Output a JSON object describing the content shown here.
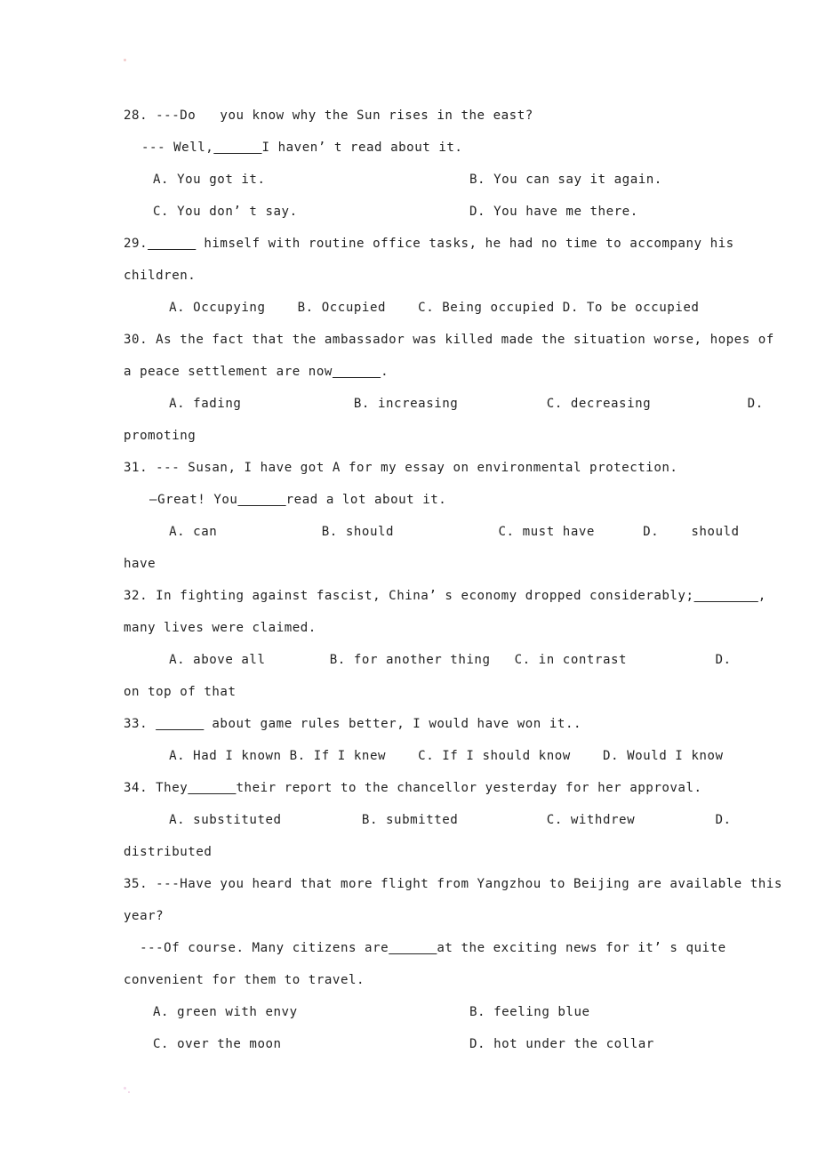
{
  "document": {
    "type": "exam-worksheet",
    "language": "en",
    "page_background": "#ffffff",
    "text_color": "#222222"
  },
  "questions": [
    {
      "number": "28.",
      "stem_lines": [
        "28. ---Do   you know why the Sun rises in the east?",
        "--- Well,______I haven’ t read about it."
      ],
      "option_rows": [
        {
          "left": "A. You got it.",
          "right": "B. You can say it again."
        },
        {
          "left": "C. You don’ t say.",
          "right": "D. You have me there."
        }
      ]
    },
    {
      "number": "29.",
      "stem_lines": [
        "29.______ himself with routine office tasks, he had no time to accompany his",
        "children."
      ],
      "inline_options": "  A. Occupying    B. Occupied    C. Being occupied D. To be occupied"
    },
    {
      "number": "30.",
      "stem_lines": [
        "30. As the fact that the ambassador was killed made the situation worse, hopes of",
        "a peace settlement are now______."
      ],
      "inline_options": "  A. fading              B. increasing           C. decreasing            D.",
      "inline_options_wrap": "promoting"
    },
    {
      "number": "31.",
      "stem_lines": [
        "31. --- Susan, I have got A for my essay on environmental protection.",
        " —Great! You______read a lot about it."
      ],
      "inline_options": "  A. can             B. should             C. must have      D.    should",
      "inline_options_wrap": "have"
    },
    {
      "number": "32.",
      "stem_lines": [
        "32. In fighting against fascist, China’ s economy dropped considerably;________,",
        "many lives were claimed."
      ],
      "inline_options": "  A. above all        B. for another thing   C. in contrast           D.",
      "inline_options_wrap": "on top of that"
    },
    {
      "number": "33.",
      "stem_lines": [
        "33. ______ about game rules better, I would have won it.."
      ],
      "inline_options": "  A. Had I known B. If I knew    C. If I should know    D. Would I know"
    },
    {
      "number": "34.",
      "stem_lines": [
        "34. They______their report to the chancellor yesterday for her approval."
      ],
      "inline_options": "  A. substituted          B. submitted           C. withdrew          D.",
      "inline_options_wrap": "distributed"
    },
    {
      "number": "35.",
      "stem_lines": [
        "35. ---Have you heard that more flight from Yangzhou to Beijing are available this",
        "year?",
        "  ---Of course. Many citizens are______at the exciting news for it’ s quite",
        "convenient for them to travel."
      ],
      "option_rows": [
        {
          "left": "A. green with envy",
          "right": "B. feeling blue"
        },
        {
          "left": "C. over the moon",
          "right": "D. hot under the collar"
        }
      ]
    }
  ]
}
